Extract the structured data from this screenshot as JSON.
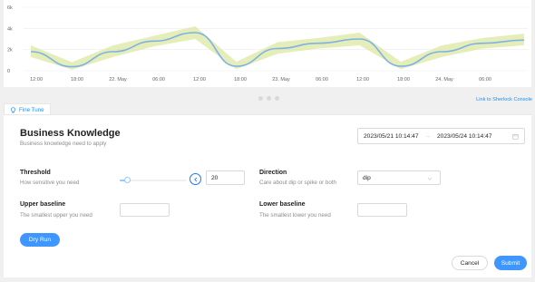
{
  "chart": {
    "y_ticks": [
      "6k",
      "4k",
      "2k",
      "0"
    ],
    "x_ticks": [
      "12:00",
      "18:00",
      "22. May",
      "06:00",
      "12:00",
      "18:00",
      "23. May",
      "06:00",
      "12:00",
      "18:00",
      "24. May",
      "06:00"
    ]
  },
  "chart_data": {
    "type": "line",
    "title": "",
    "xlabel": "",
    "ylabel": "",
    "ylim": [
      0,
      6000
    ],
    "x": [
      "21 May 12:00",
      "21 May 18:00",
      "22 May 00:00",
      "22 May 06:00",
      "22 May 12:00",
      "22 May 18:00",
      "23 May 00:00",
      "23 May 06:00",
      "23 May 12:00",
      "23 May 18:00",
      "24 May 00:00",
      "24 May 06:00",
      "24 May 10:00"
    ],
    "series": [
      {
        "values": [
          1800,
          380,
          1800,
          2800,
          3600,
          420,
          2100,
          2600,
          3000,
          420,
          1800,
          2600,
          2900
        ]
      }
    ],
    "band": {
      "lower": [
        1300,
        100,
        1300,
        2300,
        3000,
        150,
        1600,
        2100,
        2400,
        150,
        1300,
        2100,
        2400
      ],
      "upper": [
        2400,
        800,
        2400,
        3300,
        4200,
        850,
        2700,
        3100,
        3600,
        850,
        2400,
        3100,
        3500
      ]
    },
    "grid": true,
    "colors": {
      "line": "#7eb2e6",
      "band": "#dfe8a8"
    }
  },
  "link_console": "Link to Sherlock Console",
  "tab": {
    "label": "Fine Tune"
  },
  "business": {
    "title": "Business Knowledge",
    "subtitle": "Business knowledge need to apply",
    "range_start": "2023/05/21 10:14:47",
    "range_end": "2023/05/24 10:14:47"
  },
  "threshold": {
    "label": "Threshold",
    "desc": "How sensitive you need",
    "value": "20",
    "slider_fraction": 0.12
  },
  "direction": {
    "label": "Direction",
    "desc": "Care about dip or spike or both",
    "value": "dip"
  },
  "upper": {
    "label": "Upper baseline",
    "desc": "The smallest upper you need",
    "value": ""
  },
  "lower": {
    "label": "Lower baseline",
    "desc": "The smallest lower you need",
    "value": ""
  },
  "buttons": {
    "dry_run": "Dry Run",
    "cancel": "Cancel",
    "submit": "Submit"
  },
  "colors": {
    "accent": "#1677ff",
    "primary_btn": "#4096ff"
  }
}
